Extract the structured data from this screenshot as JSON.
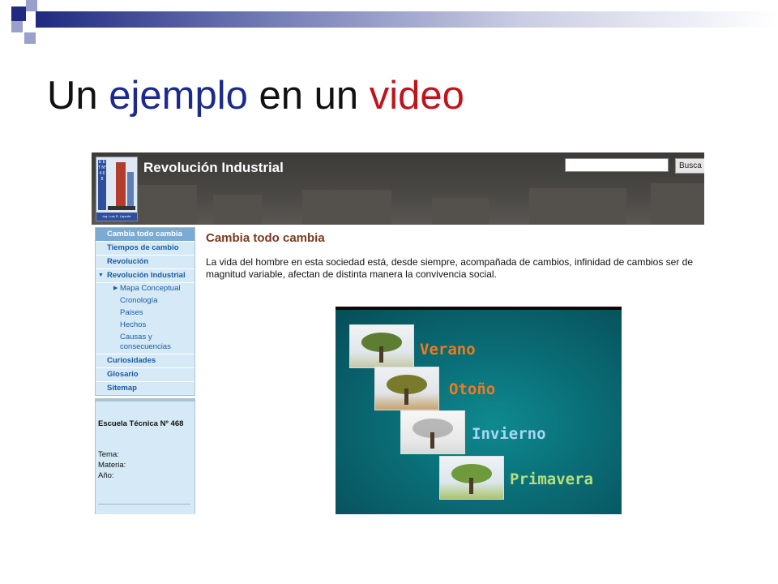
{
  "slide": {
    "title_parts": [
      {
        "text": "Un ",
        "color": "#111111"
      },
      {
        "text": "ejemplo",
        "color": "#1c2a8c"
      },
      {
        "text": " en un ",
        "color": "#111111"
      },
      {
        "text": "video",
        "color": "#c0141c"
      }
    ],
    "colors": {
      "square_dark": "#1f2a80",
      "square_light": "#9aa0cc"
    }
  },
  "site": {
    "title": "Revolución Industrial",
    "search": {
      "value": "",
      "button_label": "Busca"
    },
    "logo": {
      "strip_text": "E E T N° 4 6 8",
      "caption": "Ing. Luis R. Laporte"
    },
    "nav": {
      "items": [
        {
          "label": "Cambia todo cambia",
          "active": true
        },
        {
          "label": "Tiempos de cambio"
        },
        {
          "label": "Revolución"
        },
        {
          "label": "Revolución Industrial",
          "expanded": true
        }
      ],
      "sub_items": [
        {
          "label": "Mapa Conceptual",
          "has_arrow": true
        },
        {
          "label": "Cronología"
        },
        {
          "label": "Paises"
        },
        {
          "label": "Hechos"
        },
        {
          "label": "Causas y consecuencias"
        }
      ],
      "more_items": [
        {
          "label": "Curiosidades"
        },
        {
          "label": "Glosario"
        },
        {
          "label": "Sitemap"
        }
      ]
    },
    "info": {
      "school": "Escuela Técnica Nº 468",
      "tema": "Tema:",
      "materia": "Materia:",
      "anio": "Año:"
    },
    "content": {
      "title": "Cambia todo cambia",
      "paragraph": "La vida del hombre en esta sociedad está, desde siempre, acompañada de cambios, infinidad de cambios ser de magnitud variable, afectan de distinta manera la convivencia social."
    },
    "video": {
      "seasons": [
        {
          "label": "Verano",
          "color": "#f07a1e",
          "image": "summer-tree"
        },
        {
          "label": "Otoño",
          "color": "#f07a1e",
          "image": "autumn-tree"
        },
        {
          "label": "Invierno",
          "color": "#a9d6f5",
          "image": "winter-tree"
        },
        {
          "label": "Primavera",
          "color": "#b7e07a",
          "image": "spring-tree"
        }
      ]
    }
  }
}
